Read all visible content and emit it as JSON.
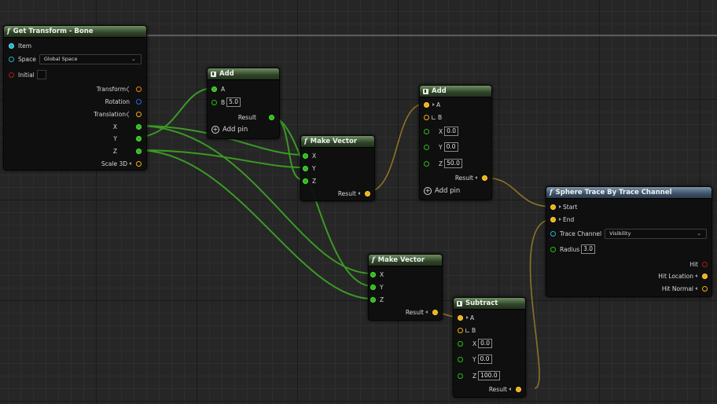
{
  "get_transform": {
    "title": "Get Transform - Bone",
    "item": "Item",
    "space_label": "Space",
    "space_value": "Global Space",
    "initial": "Initial",
    "outputs": [
      "Transform",
      "Rotation",
      "Translation",
      "X",
      "Y",
      "Z",
      "Scale 3D"
    ]
  },
  "add1": {
    "title": "Add",
    "a": "A",
    "b": "B",
    "b_value": "5.0",
    "result": "Result",
    "add_pin": "Add pin"
  },
  "make_vector1": {
    "title": "Make Vector",
    "x": "X",
    "y": "Y",
    "z": "Z",
    "result": "Result"
  },
  "add2": {
    "title": "Add",
    "a": "A",
    "b": "B",
    "x": "X",
    "x_value": "0.0",
    "y": "Y",
    "y_value": "0.0",
    "z": "Z",
    "z_value": "50.0",
    "result": "Result",
    "add_pin": "Add pin"
  },
  "sphere_trace": {
    "title": "Sphere Trace By Trace Channel",
    "start": "Start",
    "end": "End",
    "trace_channel": "Trace Channel",
    "trace_channel_value": "Visibility",
    "radius": "Radius",
    "radius_value": "3.0",
    "hit": "Hit",
    "hit_location": "Hit Location",
    "hit_normal": "Hit Normal"
  },
  "make_vector2": {
    "title": "Make Vector",
    "x": "X",
    "y": "Y",
    "z": "Z",
    "result": "Result"
  },
  "subtract": {
    "title": "Subtract",
    "a": "A",
    "b": "B",
    "x": "X",
    "x_value": "0.0",
    "y": "Y",
    "y_value": "0.0",
    "z": "Z",
    "z_value": "100.0",
    "result": "Result"
  },
  "colors": {
    "float_wire": "#3a9a24",
    "vector_wire": "#8a7428",
    "canvas_bg": "#262626"
  }
}
